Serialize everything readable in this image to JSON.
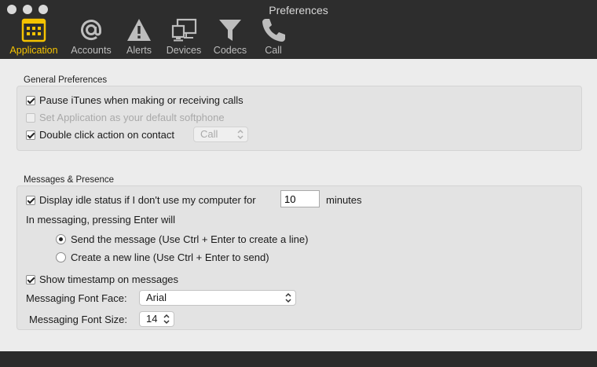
{
  "window": {
    "title": "Preferences"
  },
  "toolbar": {
    "tabs": [
      {
        "label": "Application",
        "icon": "calendar-grid-icon",
        "active": true
      },
      {
        "label": "Accounts",
        "icon": "at-sign-icon",
        "active": false
      },
      {
        "label": "Alerts",
        "icon": "warning-triangle-icon",
        "active": false
      },
      {
        "label": "Devices",
        "icon": "monitor-devices-icon",
        "active": false
      },
      {
        "label": "Codecs",
        "icon": "funnel-icon",
        "active": false
      },
      {
        "label": "Call",
        "icon": "phone-icon",
        "active": false
      }
    ],
    "active_color": "#f5c300",
    "inactive_color": "#bdbdbd"
  },
  "general": {
    "title": "General Preferences",
    "pause_itunes": {
      "label": "Pause iTunes when making or receiving calls",
      "checked": true
    },
    "default_softphone": {
      "label": "Set Application as your default softphone",
      "checked": false,
      "disabled": true
    },
    "double_click": {
      "label": "Double click action on contact",
      "checked": true,
      "value": "Call"
    }
  },
  "messaging": {
    "title": "Messages & Presence",
    "idle": {
      "label": "Display idle status if I don't use my computer for",
      "checked": true,
      "value": "10",
      "suffix": "minutes"
    },
    "enter_label": "In messaging, pressing Enter will",
    "enter_options": [
      {
        "label": "Send the message (Use Ctrl + Enter to create a line)",
        "selected": true
      },
      {
        "label": "Create a new line (Use Ctrl + Enter to send)",
        "selected": false
      }
    ],
    "timestamp": {
      "label": "Show timestamp on messages",
      "checked": true
    },
    "font_face": {
      "label": "Messaging Font Face:",
      "value": "Arial"
    },
    "font_size": {
      "label": "Messaging Font Size:",
      "value": "14"
    }
  }
}
